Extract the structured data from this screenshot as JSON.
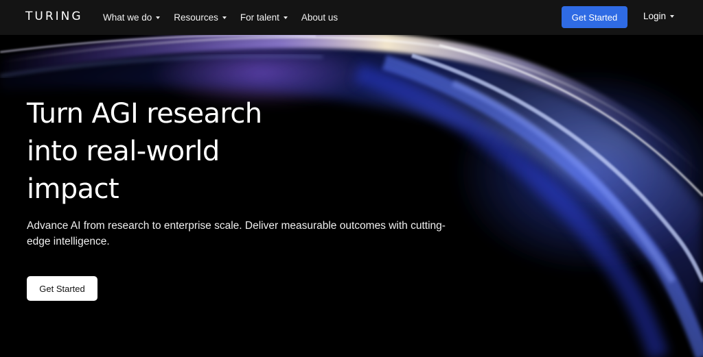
{
  "brand": {
    "logo_text": "TURING"
  },
  "nav": {
    "items": [
      {
        "label": "What we do",
        "has_dropdown": true
      },
      {
        "label": "Resources",
        "has_dropdown": true
      },
      {
        "label": "For talent",
        "has_dropdown": true
      },
      {
        "label": "About us",
        "has_dropdown": false
      }
    ],
    "cta_label": "Get Started",
    "login_label": "Login"
  },
  "hero": {
    "title_lines": [
      "Turn AGI research",
      "into real-world",
      "impact"
    ],
    "subtitle": "Advance AI from research to enterprise scale. Deliver measurable outcomes with cutting-edge intelligence.",
    "cta_label": "Get Started"
  },
  "colors": {
    "nav_background": "#141414",
    "accent_blue": "#2f6be4",
    "hero_background": "#000000"
  },
  "icons": [
    "caret-down-icon"
  ]
}
